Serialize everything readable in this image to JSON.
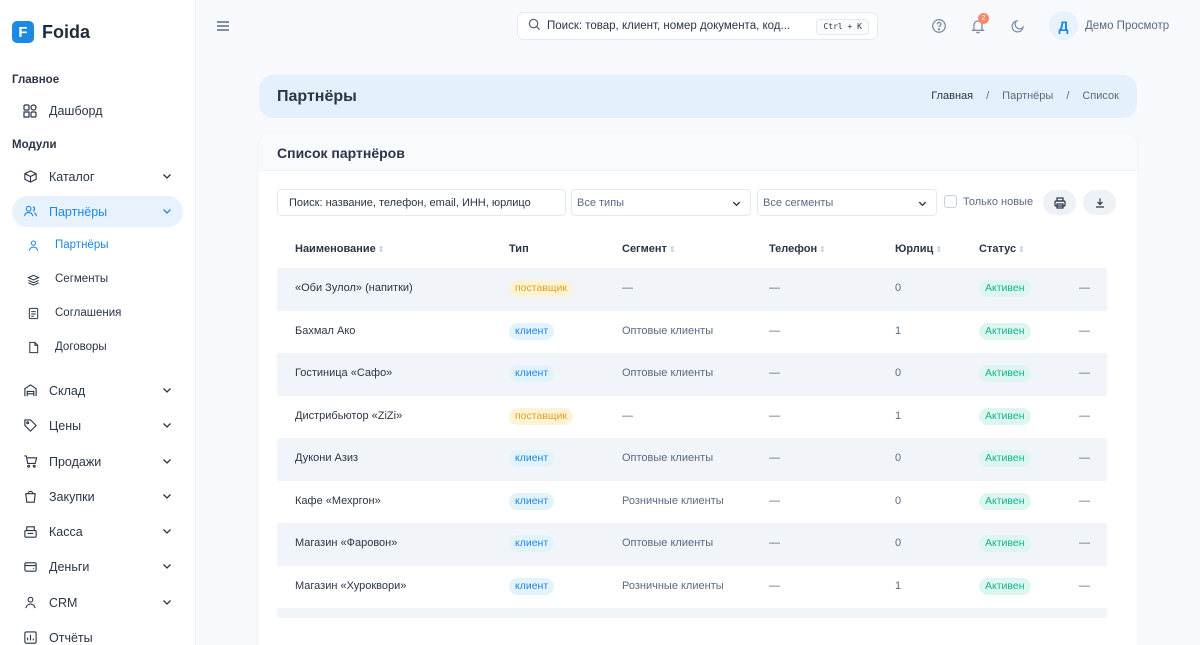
{
  "app": {
    "name": "Foida",
    "logo_letter": "F"
  },
  "sidebar": {
    "section_main": "Главное",
    "section_modules": "Модули",
    "dashboard": "Дашборд",
    "items": [
      {
        "label": "Каталог",
        "icon": "box-icon"
      },
      {
        "label": "Партнёры",
        "icon": "users-icon",
        "active": true
      },
      {
        "label": "Склад",
        "icon": "warehouse-icon"
      },
      {
        "label": "Цены",
        "icon": "tag-icon"
      },
      {
        "label": "Продажи",
        "icon": "cart-icon"
      },
      {
        "label": "Закупки",
        "icon": "bag-icon"
      },
      {
        "label": "Касса",
        "icon": "register-icon"
      },
      {
        "label": "Деньги",
        "icon": "wallet-icon"
      },
      {
        "label": "CRM",
        "icon": "crm-icon"
      },
      {
        "label": "Отчёты",
        "icon": "chart-icon"
      }
    ],
    "sub_items": [
      {
        "label": "Партнёры",
        "active": true
      },
      {
        "label": "Сегменты"
      },
      {
        "label": "Соглашения"
      },
      {
        "label": "Договоры"
      }
    ]
  },
  "topbar": {
    "search_placeholder": "Поиск: товар, клиент, номер документа, код...",
    "shortcut": "Ctrl + K",
    "notification_count": "2",
    "user_initial": "Д",
    "user_name": "Демо Просмотр"
  },
  "page": {
    "title": "Партнёры",
    "breadcrumbs": [
      "Главная",
      "/",
      "Партнёры",
      "/",
      "Список"
    ]
  },
  "card": {
    "title": "Список партнёров",
    "filters": {
      "search_placeholder": "Поиск: название, телефон, email, ИНН, юрлицо",
      "type_select": "Все типы",
      "segment_select": "Все сегменты",
      "only_new": "Только новые"
    },
    "columns": [
      "Наименование",
      "Тип",
      "Сегмент",
      "Телефон",
      "Юрлиц",
      "Статус"
    ],
    "rows": [
      {
        "name": "«Оби Зулол» (напитки)",
        "type": "поставщик",
        "type_kind": "supplier",
        "segment": "—",
        "phone": "—",
        "entities": "0",
        "status": "Активен",
        "extra": "—"
      },
      {
        "name": "Бахмал Ако",
        "type": "клиент",
        "type_kind": "client",
        "segment": "Оптовые клиенты",
        "phone": "—",
        "entities": "1",
        "status": "Активен",
        "extra": "—"
      },
      {
        "name": "Гостиница «Сафо»",
        "type": "клиент",
        "type_kind": "client",
        "segment": "Оптовые клиенты",
        "phone": "—",
        "entities": "0",
        "status": "Активен",
        "extra": "—"
      },
      {
        "name": "Дистрибьютор «ZiZi»",
        "type": "поставщик",
        "type_kind": "supplier",
        "segment": "—",
        "phone": "—",
        "entities": "1",
        "status": "Активен",
        "extra": "—"
      },
      {
        "name": "Дукони Азиз",
        "type": "клиент",
        "type_kind": "client",
        "segment": "Оптовые клиенты",
        "phone": "—",
        "entities": "0",
        "status": "Активен",
        "extra": "—"
      },
      {
        "name": "Кафе «Мехргон»",
        "type": "клиент",
        "type_kind": "client",
        "segment": "Розничные клиенты",
        "phone": "—",
        "entities": "0",
        "status": "Активен",
        "extra": "—"
      },
      {
        "name": "Магазин «Фаровон»",
        "type": "клиент",
        "type_kind": "client",
        "segment": "Оптовые клиенты",
        "phone": "—",
        "entities": "0",
        "status": "Активен",
        "extra": "—"
      },
      {
        "name": "Магазин «Хуроквори»",
        "type": "клиент",
        "type_kind": "client",
        "segment": "Розничные клиенты",
        "phone": "—",
        "entities": "1",
        "status": "Активен",
        "extra": "—"
      }
    ]
  },
  "colors": {
    "accent": "#1e88e5",
    "text": "#2a3547",
    "success": "#13b38e",
    "warning": "#e0a314"
  }
}
